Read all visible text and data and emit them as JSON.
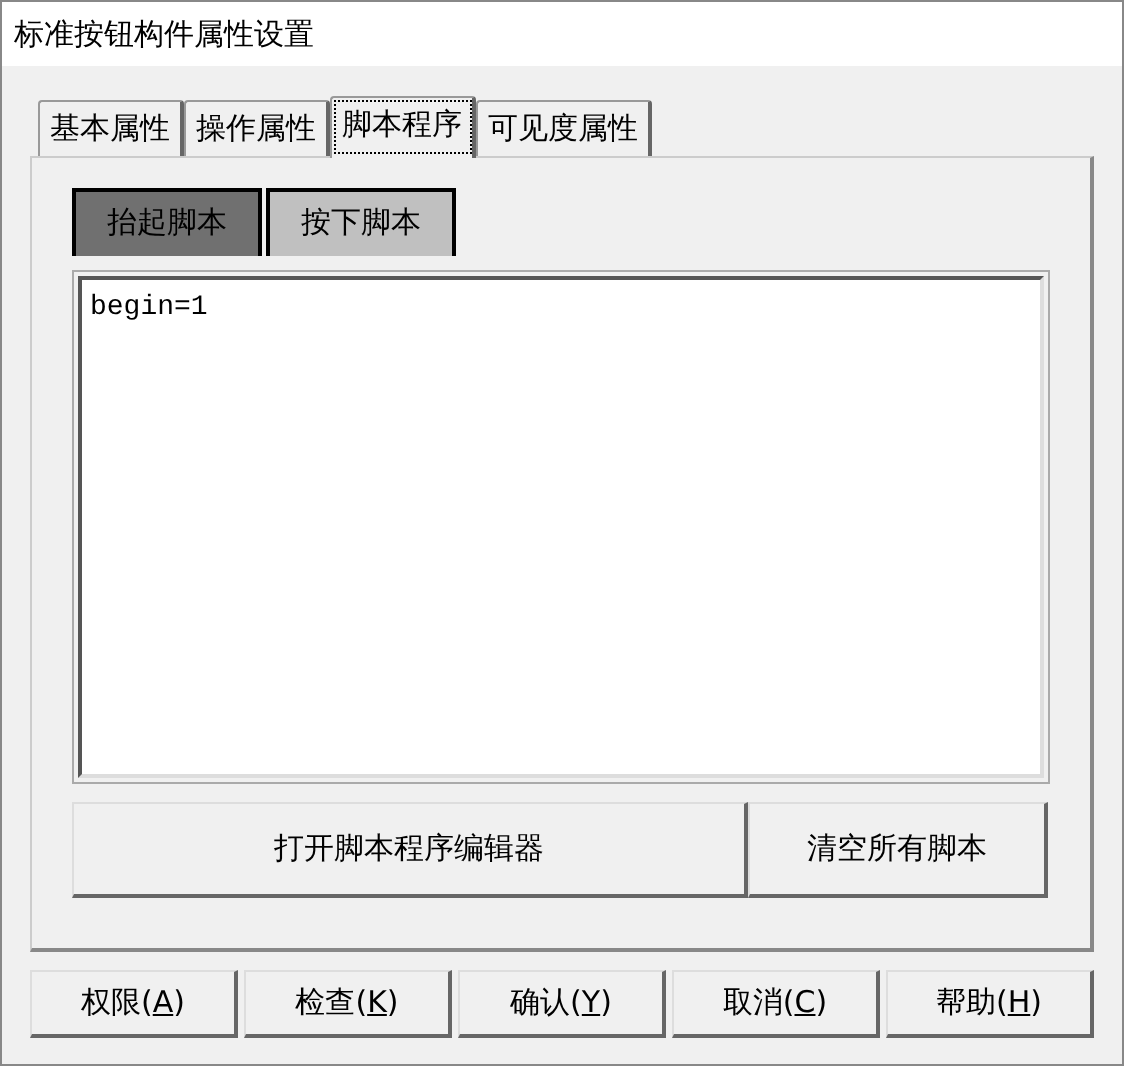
{
  "window": {
    "title": "标准按钮构件属性设置"
  },
  "tabs": [
    {
      "label": "基本属性",
      "selected": false
    },
    {
      "label": "操作属性",
      "selected": false
    },
    {
      "label": "脚本程序",
      "selected": true
    },
    {
      "label": "可见度属性",
      "selected": false
    }
  ],
  "script_tabs": [
    {
      "label": "抬起脚本",
      "selected": true
    },
    {
      "label": "按下脚本",
      "selected": false
    }
  ],
  "script_editor": {
    "value": "begin=1"
  },
  "panel_buttons": [
    "打开脚本程序编辑器",
    "清空所有脚本"
  ],
  "buttons": [
    {
      "before": "权限(",
      "hotkey": "A",
      "after": ")"
    },
    {
      "before": "检查(",
      "hotkey": "K",
      "after": ")"
    },
    {
      "before": "确认(",
      "hotkey": "Y",
      "after": ")"
    },
    {
      "before": "取消(",
      "hotkey": "C",
      "after": ")"
    },
    {
      "before": "帮助(",
      "hotkey": "H",
      "after": ")"
    }
  ]
}
